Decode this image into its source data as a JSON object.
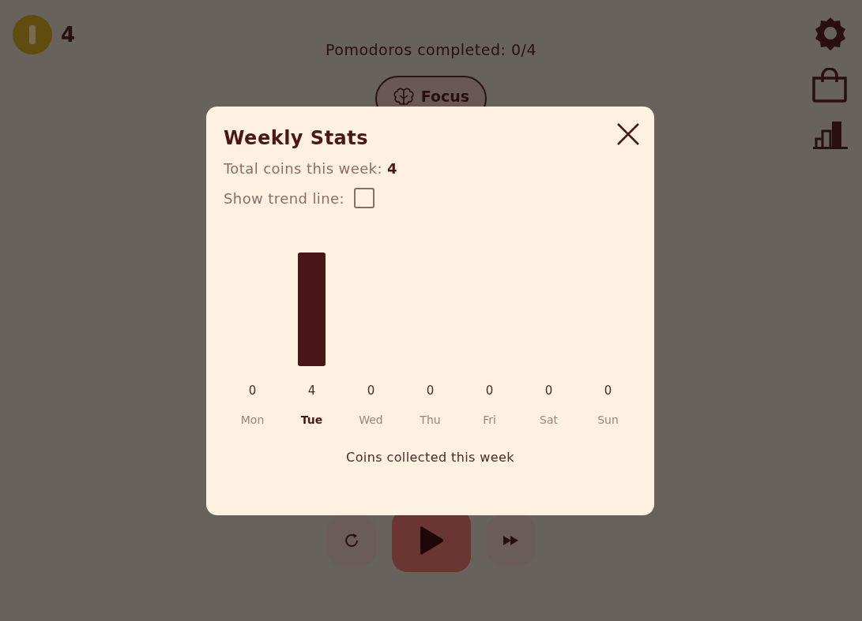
{
  "coins": {
    "count": "4"
  },
  "pomodoros": {
    "text": "Pomodoros completed: 0/4"
  },
  "mode_button": {
    "label": "Focus"
  },
  "controls": [
    {
      "kind": "reset"
    },
    {
      "kind": "play"
    },
    {
      "kind": "skip"
    }
  ],
  "side_icons": [
    {
      "kind": "settings"
    },
    {
      "kind": "shop"
    },
    {
      "kind": "stats"
    }
  ],
  "modal": {
    "title": "Weekly Stats",
    "total_label": "Total coins this week:",
    "total_value": "4",
    "trend_label": "Show trend line:",
    "trend_checked": false,
    "days": [
      {
        "selected": false
      },
      {
        "selected": true
      },
      {
        "selected": false
      },
      {
        "selected": false
      },
      {
        "selected": false
      },
      {
        "selected": false
      },
      {
        "selected": false
      }
    ],
    "chart_data": {
      "type": "bar",
      "xlabel": "Coins collected this week",
      "categories": [
        "Mon",
        "Tue",
        "Wed",
        "Thu",
        "Fri",
        "Sat",
        "Sun"
      ],
      "values": [
        0,
        4,
        0,
        0,
        0,
        0,
        0
      ],
      "ylim": [
        0,
        4
      ],
      "data_labels": true,
      "value_labels": [
        "0",
        "4",
        "0",
        "0",
        "0",
        "0",
        "0"
      ]
    }
  }
}
